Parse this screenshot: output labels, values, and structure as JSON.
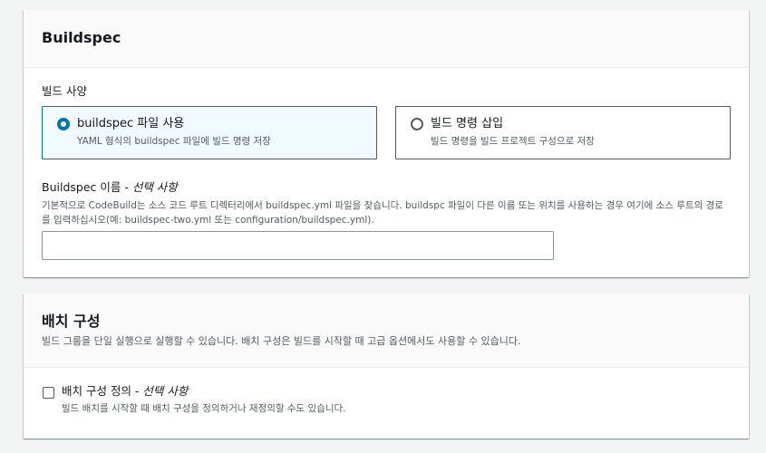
{
  "buildspec_section": {
    "title": "Buildspec",
    "build_spec_label": "빌드 사양",
    "options": [
      {
        "title": "buildspec 파일 사용",
        "description": "YAML 형식의 buildspec 파일에 빌드 명령 저장",
        "selected": true
      },
      {
        "title": "빌드 명령 삽입",
        "description": "빌드 명령을 빌드 프로젝트 구성으로 저장",
        "selected": false
      }
    ],
    "buildspec_name": {
      "label": "Buildspec 이름 - ",
      "optional": "선택 사항",
      "help_text": "기본적으로 CodeBuild는 소스 코드 루트 디렉터리에서 buildspec.yml 파일을 찾습니다. buildspc 파일이 다른 이름 또는 위치를 사용하는 경우 여기에 소스 루트의 경로를 입력하십시오(예: buildspec-two.yml 또는 configuration/buildspec.yml).",
      "value": "",
      "placeholder": ""
    }
  },
  "batch_section": {
    "title": "배치 구성",
    "description": "빌드 그룹을 단일 실행으로 실행할 수 있습니다. 배치 구성은 빌드를 시작할 때 고급 옵션에서도 사용할 수 있습니다.",
    "checkbox": {
      "label": "배치 구성 정의 - ",
      "optional": "선택 사항",
      "description": "빌드 배치를 시작할 때 배치 구성을 정의하거나 재정의할 수도 있습니다.",
      "checked": false
    }
  },
  "colors": {
    "accent": "#0073bb",
    "selected_bg": "#f1faff",
    "page_bg": "#f2f3f3",
    "secondary_text": "#545b64"
  }
}
